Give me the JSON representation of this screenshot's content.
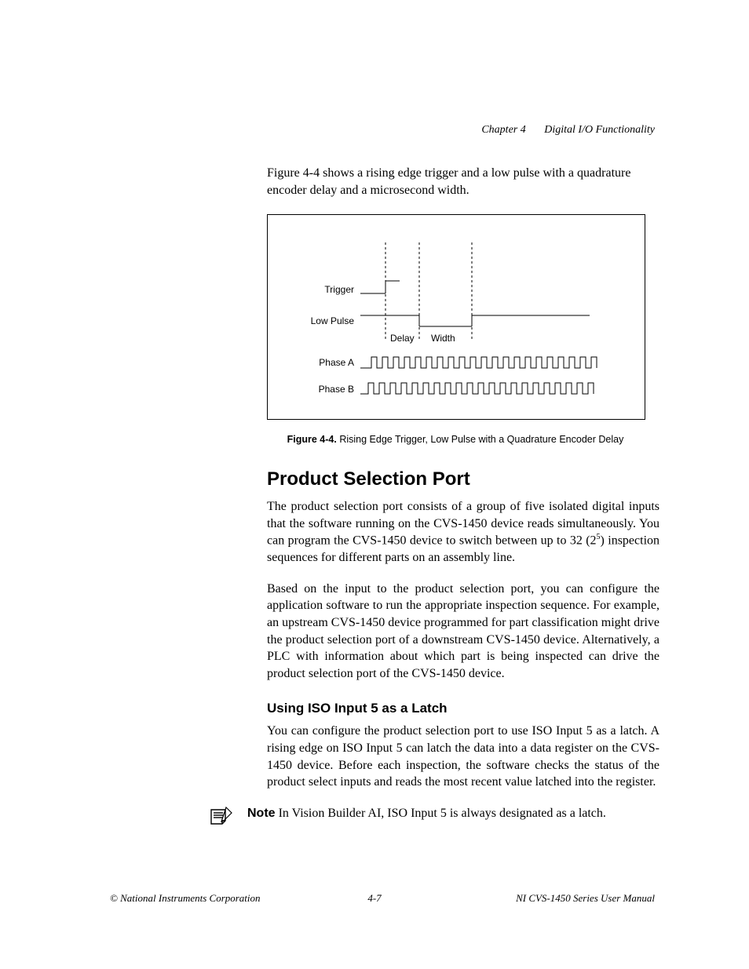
{
  "header": {
    "chapter": "Chapter 4",
    "title": "Digital I/O Functionality"
  },
  "intro": "Figure 4-4 shows a rising edge trigger and a low pulse with a quadrature encoder delay and a microsecond width.",
  "figure": {
    "labels": {
      "trigger": "Trigger",
      "lowpulse": "Low Pulse",
      "phaseA": "Phase A",
      "phaseB": "Phase B",
      "delay": "Delay",
      "width": "Width"
    },
    "caption_bold": "Figure 4-4.",
    "caption_rest": "  Rising Edge Trigger, Low Pulse with a Quadrature Encoder Delay"
  },
  "section_title": "Product Selection Port",
  "p1a": "The product selection port consists of a group of five isolated digital inputs that the software running on the CVS-1450 device reads simultaneously. You can program the CVS-1450 device to switch between up to 32 (2",
  "p1b": ") inspection sequences for different parts on an assembly line.",
  "p1_sup": "5",
  "p2": "Based on the input to the product selection port, you can configure the application software to run the appropriate inspection sequence. For example, an upstream CVS-1450 device programmed for part classification might drive the product selection port of a downstream CVS-1450 device. Alternatively, a PLC with information about which part is being inspected can drive the product selection port of the CVS-1450 device.",
  "sub_title": "Using ISO Input 5 as a Latch",
  "p3": "You can configure the product selection port to use ISO Input 5 as a latch. A rising edge on ISO Input 5 can latch the data into a data register on the CVS-1450 device. Before each inspection, the software checks the status of the product select inputs and reads the most recent value latched into the register.",
  "note_label": "Note",
  "note_text": "   In Vision Builder AI, ISO Input 5 is always designated as a latch.",
  "footer": {
    "left": "© National Instruments Corporation",
    "center": "4-7",
    "right": "NI CVS-1450 Series User Manual"
  }
}
